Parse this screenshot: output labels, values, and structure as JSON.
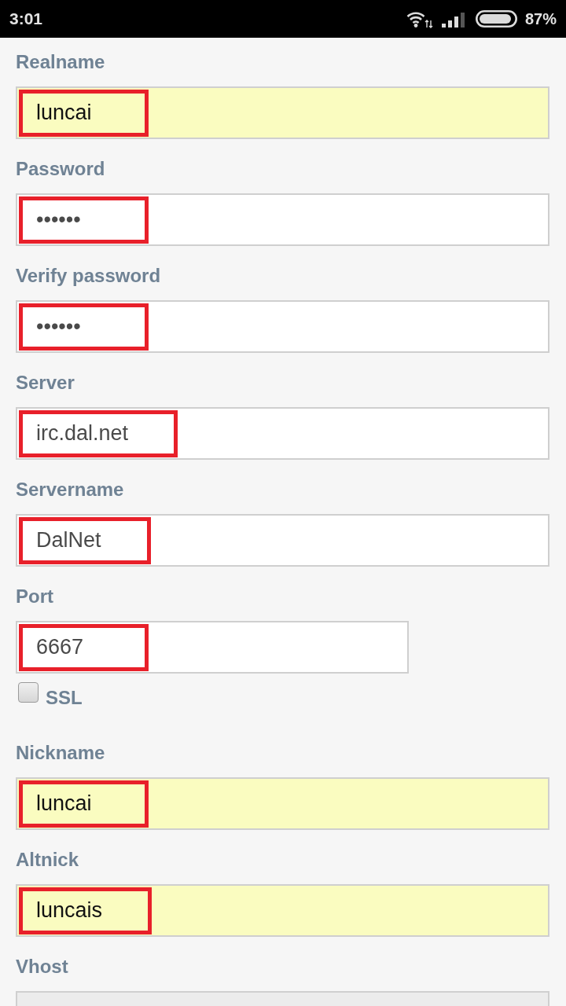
{
  "status_bar": {
    "time": "3:01",
    "battery": "87%"
  },
  "form": {
    "fields": [
      {
        "kind": "text",
        "label": "Realname",
        "value": "luncai",
        "autofilled": true,
        "highlighted": true,
        "disabled": false
      },
      {
        "kind": "password",
        "label": "Password",
        "value": "••••••",
        "autofilled": false,
        "highlighted": true,
        "disabled": false
      },
      {
        "kind": "password",
        "label": "Verify password",
        "value": "••••••",
        "autofilled": false,
        "highlighted": true,
        "disabled": false
      },
      {
        "kind": "text",
        "label": "Server",
        "value": "irc.dal.net",
        "autofilled": false,
        "highlighted": true,
        "disabled": false
      },
      {
        "kind": "text",
        "label": "Servername",
        "value": "DalNet",
        "autofilled": false,
        "highlighted": true,
        "disabled": false
      },
      {
        "kind": "number",
        "label": "Port",
        "value": "6667",
        "autofilled": false,
        "highlighted": true,
        "disabled": false
      },
      {
        "kind": "checkbox",
        "label": "SSL",
        "checked": false,
        "disabled": false
      },
      {
        "kind": "text",
        "label": "Nickname",
        "value": "luncai",
        "autofilled": true,
        "highlighted": true,
        "disabled": false
      },
      {
        "kind": "text",
        "label": "Altnick",
        "value": "luncais",
        "autofilled": true,
        "highlighted": true,
        "disabled": false
      },
      {
        "kind": "text",
        "label": "Vhost",
        "autofilled": false,
        "highlighted": false,
        "disabled": true
      }
    ]
  }
}
